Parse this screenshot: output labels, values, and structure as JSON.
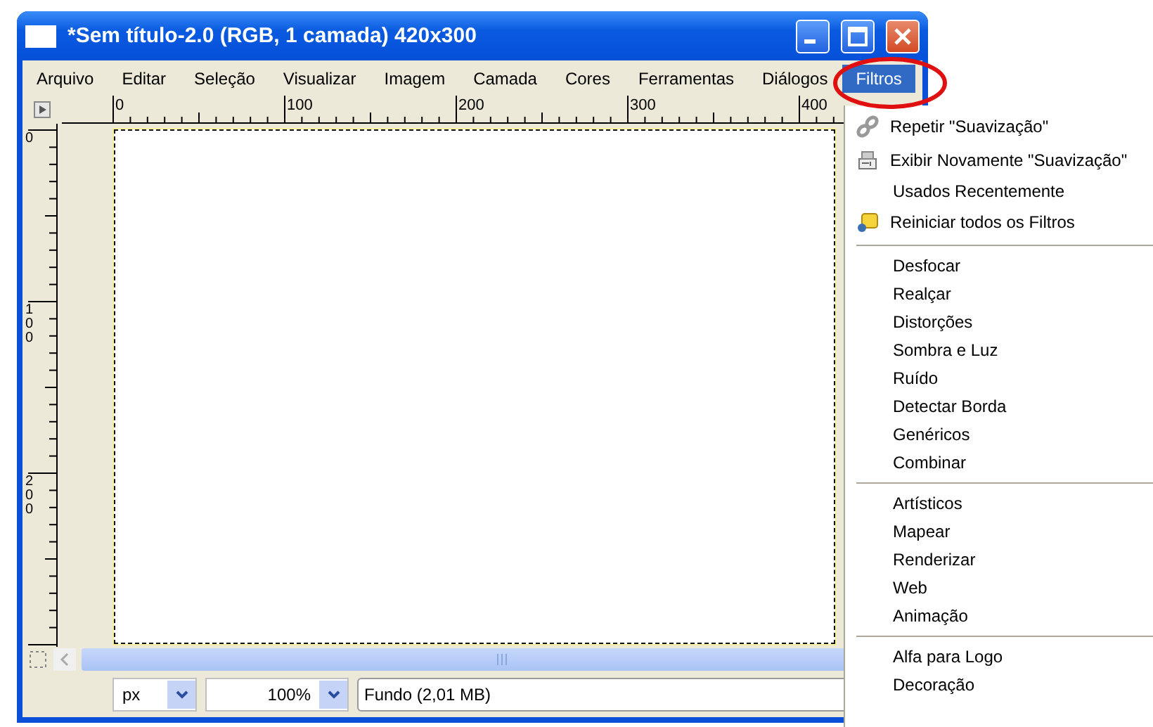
{
  "window": {
    "title": "*Sem título-2.0 (RGB, 1 camada) 420x300"
  },
  "menubar": [
    {
      "label": "Arquivo",
      "selected": false
    },
    {
      "label": "Editar",
      "selected": false
    },
    {
      "label": "Seleção",
      "selected": false
    },
    {
      "label": "Visualizar",
      "selected": false
    },
    {
      "label": "Imagem",
      "selected": false
    },
    {
      "label": "Camada",
      "selected": false
    },
    {
      "label": "Cores",
      "selected": false
    },
    {
      "label": "Ferramentas",
      "selected": false
    },
    {
      "label": "Diálogos",
      "selected": false
    },
    {
      "label": "Filtros",
      "selected": true
    }
  ],
  "hruler": {
    "labels": [
      "0",
      "100",
      "200",
      "300",
      "400"
    ]
  },
  "vruler": {
    "labels": [
      "0",
      "100",
      "200"
    ]
  },
  "statusbar": {
    "unit": "px",
    "zoom": "100%",
    "status": "Fundo (2,01 MB)"
  },
  "annotation": {
    "kind": "ellipse"
  },
  "menu": [
    {
      "kind": "icon_item",
      "label": "Repetir \"Suavização\""
    },
    {
      "kind": "icon_item",
      "label": "Exibir Novamente \"Suavização\""
    },
    {
      "kind": "item",
      "label": "Usados Recentemente"
    },
    {
      "kind": "icon_item",
      "label": "Reiniciar todos os Filtros"
    },
    {
      "kind": "separator"
    },
    {
      "kind": "item",
      "label": "Desfocar"
    },
    {
      "kind": "item",
      "label": "Realçar"
    },
    {
      "kind": "item",
      "label": "Distorções"
    },
    {
      "kind": "item",
      "label": "Sombra e Luz"
    },
    {
      "kind": "item",
      "label": "Ruído"
    },
    {
      "kind": "item",
      "label": "Detectar Borda"
    },
    {
      "kind": "item",
      "label": "Genéricos"
    },
    {
      "kind": "item",
      "label": "Combinar"
    },
    {
      "kind": "separator"
    },
    {
      "kind": "item",
      "label": "Artísticos"
    },
    {
      "kind": "item",
      "label": "Mapear"
    },
    {
      "kind": "item",
      "label": "Renderizar"
    },
    {
      "kind": "item",
      "label": "Web"
    },
    {
      "kind": "item",
      "label": "Animação"
    },
    {
      "kind": "separator"
    },
    {
      "kind": "item",
      "label": "Alfa para Logo"
    },
    {
      "kind": "item",
      "label": "Decoração"
    }
  ]
}
